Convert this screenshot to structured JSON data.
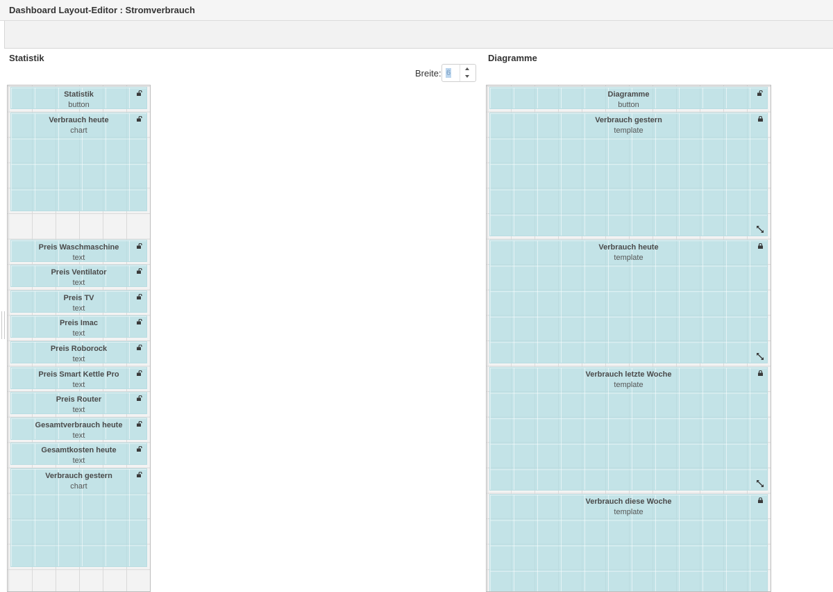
{
  "window": {
    "title": "Dashboard Layout-Editor : Stromverbrauch"
  },
  "breite": {
    "label": "Breite:",
    "value": "6"
  },
  "left": {
    "title": "Statistik",
    "widgets": [
      {
        "name": "Statistik",
        "type": "button",
        "locked": false,
        "resizable": false
      },
      {
        "name": "Verbrauch heute",
        "type": "chart",
        "locked": false,
        "resizable": false
      },
      {
        "name": "Preis Waschmaschine",
        "type": "text",
        "locked": false,
        "resizable": false
      },
      {
        "name": "Preis Ventilator",
        "type": "text",
        "locked": false,
        "resizable": false
      },
      {
        "name": "Preis TV",
        "type": "text",
        "locked": false,
        "resizable": false
      },
      {
        "name": "Preis Imac",
        "type": "text",
        "locked": false,
        "resizable": false
      },
      {
        "name": "Preis Roborock",
        "type": "text",
        "locked": false,
        "resizable": false
      },
      {
        "name": "Preis Smart Kettle Pro",
        "type": "text",
        "locked": false,
        "resizable": false
      },
      {
        "name": "Preis Router",
        "type": "text",
        "locked": false,
        "resizable": false
      },
      {
        "name": "Gesamtverbrauch heute",
        "type": "text",
        "locked": false,
        "resizable": false
      },
      {
        "name": "Gesamtkosten heute",
        "type": "text",
        "locked": false,
        "resizable": false
      },
      {
        "name": "Verbrauch gestern",
        "type": "chart",
        "locked": false,
        "resizable": false
      }
    ]
  },
  "right": {
    "title": "Diagramme",
    "widgets": [
      {
        "name": "Diagramme",
        "type": "button",
        "locked": false,
        "resizable": false
      },
      {
        "name": "Verbrauch gestern",
        "type": "template",
        "locked": true,
        "resizable": true
      },
      {
        "name": "Verbrauch heute",
        "type": "template",
        "locked": true,
        "resizable": true
      },
      {
        "name": "Verbrauch letzte Woche",
        "type": "template",
        "locked": true,
        "resizable": true
      },
      {
        "name": "Verbrauch diese Woche",
        "type": "template",
        "locked": true,
        "resizable": false
      }
    ]
  },
  "colors": {
    "widget": "#b0dce2",
    "grid": "#f3f3f3",
    "gridline": "#d9d9d9"
  },
  "icons": {
    "unlocked": "lock-open-icon",
    "locked": "lock-closed-icon",
    "resize": "resize-diagonal-icon"
  }
}
